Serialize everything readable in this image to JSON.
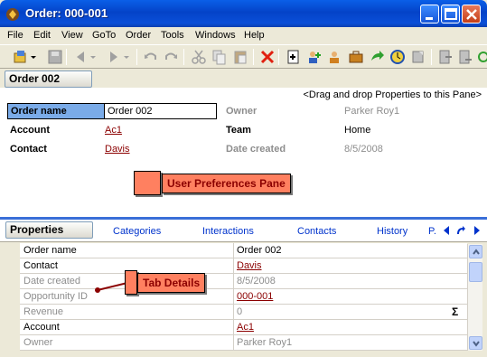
{
  "window": {
    "title": "Order: 000-001"
  },
  "menu": [
    "File",
    "Edit",
    "View",
    "GoTo",
    "Order",
    "Tools",
    "Windows",
    "Help"
  ],
  "header": {
    "section_label": "Order 002",
    "drag_hint": "<Drag and drop Properties to this Pane>",
    "order_name_label": "Order name",
    "order_name_value": "Order 002",
    "account_label": "Account",
    "account_value": "Ac1",
    "contact_label": "Contact",
    "contact_value": "Davis",
    "owner_label": "Owner",
    "owner_value": "Parker Roy1",
    "team_label": "Team",
    "team_value": "Home",
    "date_created_label": "Date created",
    "date_created_value": "8/5/2008"
  },
  "callouts": {
    "user_prefs": "User Preferences Pane",
    "tab_details": "Tab Details"
  },
  "tabs": {
    "active": "Properties",
    "items": [
      "Categories",
      "Interactions",
      "Contacts",
      "History",
      "P."
    ]
  },
  "grid": {
    "rows": [
      {
        "name": "Order name",
        "value": "Order 002",
        "name_style": "normal",
        "value_style": "normal"
      },
      {
        "name": "Contact",
        "value": "Davis",
        "name_style": "normal",
        "value_style": "link"
      },
      {
        "name": "Date created",
        "value": "8/5/2008",
        "name_style": "gray",
        "value_style": "gray"
      },
      {
        "name": "Opportunity ID",
        "value": "000-001",
        "name_style": "gray",
        "value_style": "link"
      },
      {
        "name": "Revenue",
        "value": "0",
        "name_style": "gray",
        "value_style": "gray",
        "suffix": "Σ"
      },
      {
        "name": "Account",
        "value": "Ac1",
        "name_style": "normal",
        "value_style": "link"
      },
      {
        "name": "Owner",
        "value": "Parker Roy1",
        "name_style": "gray",
        "value_style": "gray"
      }
    ]
  },
  "colors": {
    "title_bar": "#0443c8",
    "callout_fill": "#ff8060",
    "callout_text": "#8b0000",
    "link": "#8b0000",
    "tab_link": "#0033cc",
    "selected_label": "#7aabe8"
  }
}
